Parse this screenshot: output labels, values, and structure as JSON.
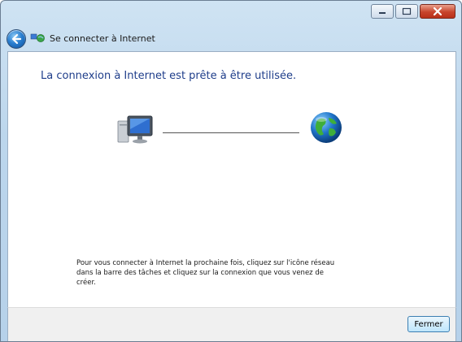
{
  "window": {
    "title": "Se connecter à Internet",
    "icons": {
      "back": "back-arrow-icon",
      "app": "network-icon",
      "minimize": "minimize-icon",
      "maximize": "maximize-icon",
      "close": "close-icon"
    }
  },
  "content": {
    "heading": "La connexion à Internet est prête à être utilisée.",
    "diagram": {
      "left_icon": "computer-icon",
      "right_icon": "globe-icon"
    },
    "info_text": "Pour vous connecter à Internet la prochaine fois, cliquez sur l'icône réseau dans la barre des tâches et cliquez sur la connexion que vous venez de créer."
  },
  "footer": {
    "close_button": "Fermer"
  },
  "colors": {
    "heading": "#1e3d8a",
    "title_bar": "#bcd6ec",
    "close_button": "#c8442c"
  }
}
